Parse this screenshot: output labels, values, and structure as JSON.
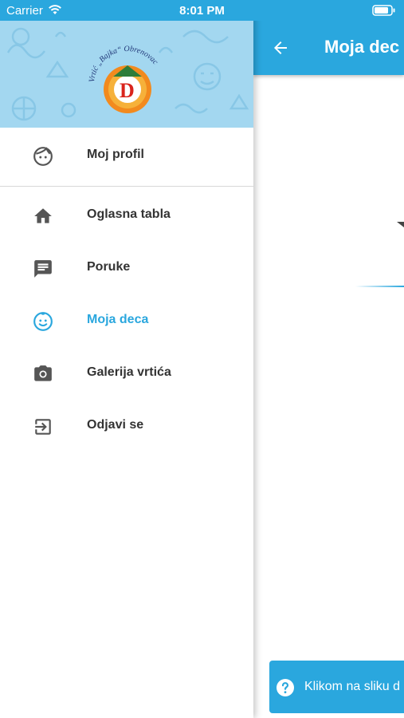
{
  "status_bar": {
    "carrier": "Carrier",
    "time": "8:01 PM"
  },
  "main_screen": {
    "title": "Moja dec",
    "hint_text": "Klikom na sliku d"
  },
  "drawer": {
    "logo": {
      "arc_text": "Vrtić „Bajka“ Obrenovac",
      "letter": "D"
    },
    "profile": {
      "label": "Moj profil",
      "icon": "face-outline-icon"
    },
    "items": [
      {
        "label": "Oglasna tabla",
        "icon": "home-icon"
      },
      {
        "label": "Poruke",
        "icon": "message-icon"
      },
      {
        "label": "Moja deca",
        "icon": "child-face-icon",
        "active": true
      },
      {
        "label": "Galerija vrtića",
        "icon": "camera-icon"
      },
      {
        "label": "Odjavi se",
        "icon": "logout-icon"
      }
    ]
  },
  "colors": {
    "accent": "#2aa7de",
    "header_bg": "#a3d7f0",
    "text": "#333333",
    "icon": "#555555"
  }
}
